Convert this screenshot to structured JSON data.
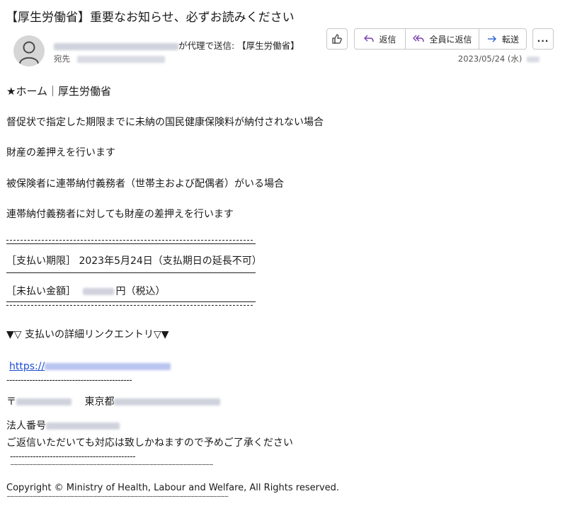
{
  "email": {
    "subject": "【厚生労働省】重要なお知らせ、必ずお読みください",
    "sender_suffix": "が代理で送信: 【厚生労働省】",
    "recipient_label": "宛先",
    "date": "2023/05/24 (水)"
  },
  "toolbar": {
    "reply_label": "返信",
    "reply_all_label": "全員に返信",
    "forward_label": "転送",
    "more_label": "..."
  },
  "body": {
    "heading": "★ホーム｜厚生労働省",
    "line1": "督促状で指定した期限までに未納の国民健康保険料が納付されない場合",
    "line2": "財産の差押えを行います",
    "line3": "被保険者に連帯納付義務者（世帯主および配偶者）がいる場合",
    "line4": "連帯納付義務者に対しても財産の差押えを行います",
    "deadline": "［支払い期限］ 2023年5月24日（支払期日の延長不可）",
    "unpaid_label": "［未払い金額］",
    "unpaid_suffix": "円（税込）",
    "link_heading": "▼▽ 支払いの詳細リンクエントリ▽▼",
    "link_text": "https://",
    "divider1": "--------------------------------------------",
    "postal_prefix": "〒",
    "address_city": "東京都",
    "corp_number_label": "法人番号",
    "notice": "ご返信いただいても対応は致しかねますので予めご了承ください",
    "divider2": "--------------------------------------------",
    "tilde1": "~~~~~~~~~~~~~~~~~~~~~~~~~~~~~~~~~~~~~~~~~~~~~~~~~~~~~~",
    "copyright": "Copyright © Ministry of Health, Labour and Welfare, All Rights reserved.",
    "tilde2": "~~~~~~~~~~~~~~~~~~~~~~~~~~~~~~~~~~~~~~~~~~~~~~~~~~~~~~~~~~~"
  }
}
